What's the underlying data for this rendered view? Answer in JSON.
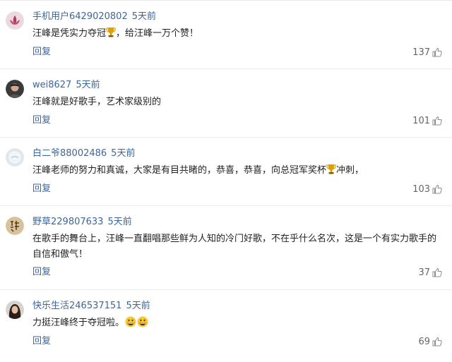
{
  "comments": [
    {
      "username": "手机用户6429020802",
      "time": "5天前",
      "text_before": "汪峰是凭实力夺冠",
      "text_after": "，给汪峰一万个赞！",
      "reply": "回复",
      "likes": "137",
      "avatar": "lotus-avatar"
    },
    {
      "username": "wei8627",
      "time": "5天前",
      "text": "汪峰就是好歌手，艺术家级别的",
      "reply": "回复",
      "likes": "101",
      "avatar": "person-photo-avatar"
    },
    {
      "username": "白二爷88002486",
      "time": "5天前",
      "text_before": "汪峰老师的努力和真诚，大家是有目共睹的，恭喜，恭喜，向总冠军奖杯",
      "text_after": "冲刺，",
      "reply": "回复",
      "likes": "103",
      "avatar": "pale-circle-avatar"
    },
    {
      "username": "野草229807633",
      "time": "5天前",
      "text_line1": "在歌手的舞台上，汪峰一直翻唱那些鲜为人知的冷门好歌，不在乎什么名次，这是一个有实力歌手的",
      "text_line2": "自信和傲气！",
      "reply": "回复",
      "likes": "37",
      "avatar": "calligraphy-avatar"
    },
    {
      "username": "快乐生活246537151",
      "time": "5天前",
      "text": "力挺汪峰终于夺冠啦。",
      "reply": "回复",
      "likes": "69",
      "avatar": "woman-photo-avatar"
    }
  ],
  "icons": {
    "like": "thumbs-up-icon",
    "trophy": "trophy-emoji",
    "grin": "grinning-face-emoji"
  },
  "colors": {
    "username": "#406599",
    "reply": "#406599",
    "text": "#222222",
    "count": "#666666",
    "divider": "#ececec"
  }
}
